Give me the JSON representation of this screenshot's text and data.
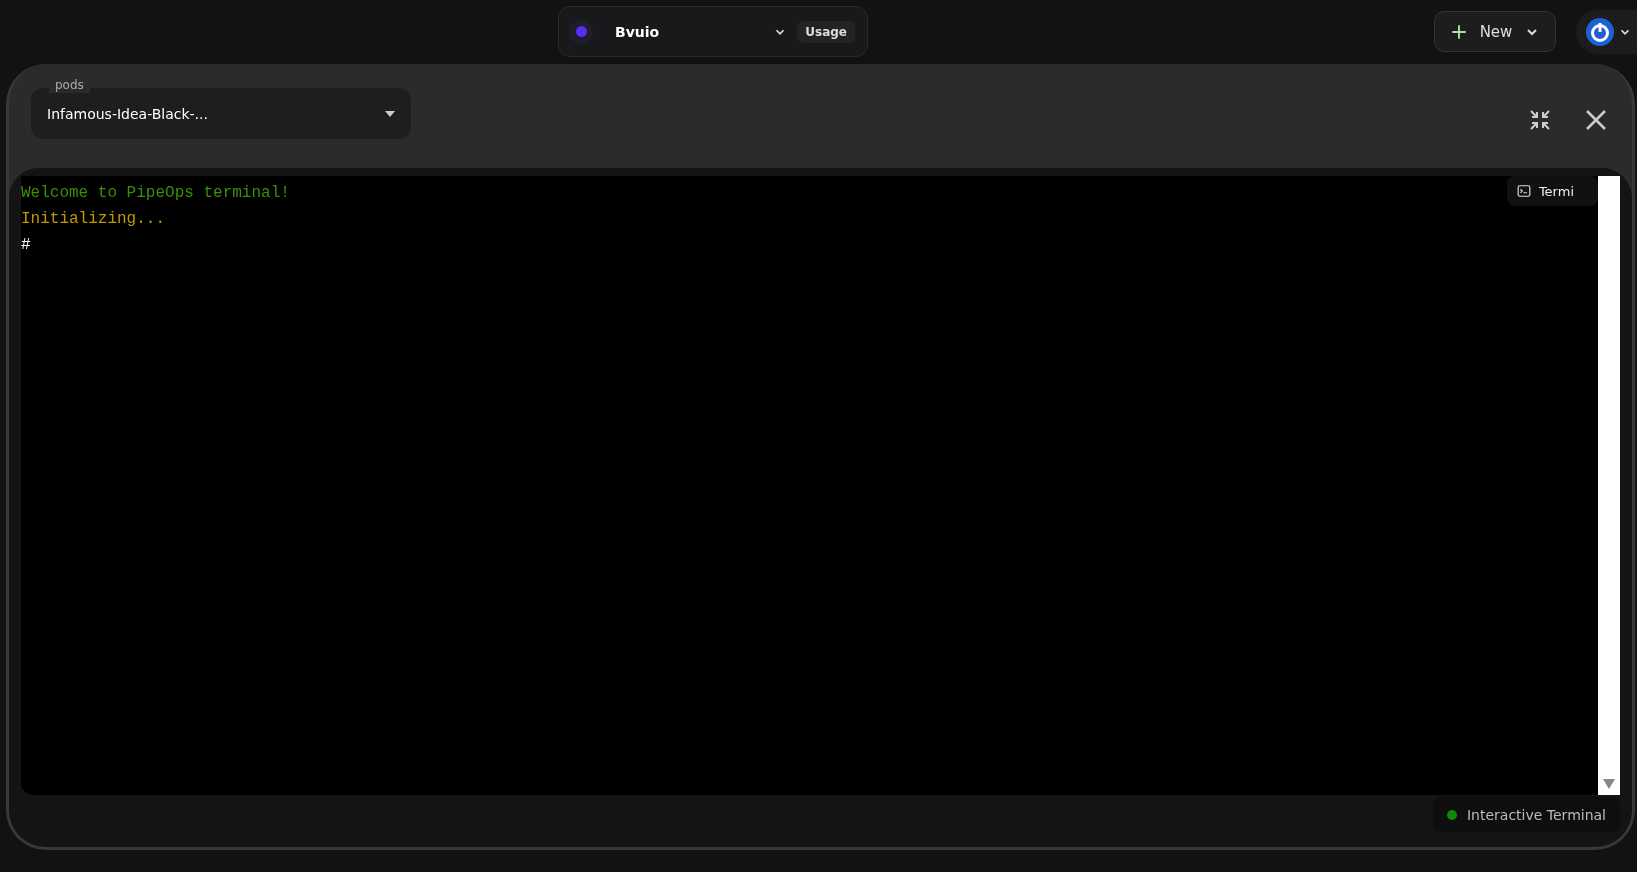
{
  "top_bar": {
    "project": {
      "name": "Bvuio",
      "usage_label": "Usage"
    },
    "new_button": {
      "label": "New"
    }
  },
  "modal": {
    "pod_select": {
      "label": "pods",
      "value": "Infamous-Idea-Black-..."
    },
    "terminal": {
      "lines": [
        {
          "kind": "success",
          "text": "Welcome to PipeOps terminal!"
        },
        {
          "kind": "info",
          "text": "Initializing..."
        },
        {
          "kind": "prompt",
          "text": "#"
        }
      ],
      "badge": "Termi"
    },
    "status": {
      "label": "Interactive Terminal",
      "connected": true
    }
  }
}
